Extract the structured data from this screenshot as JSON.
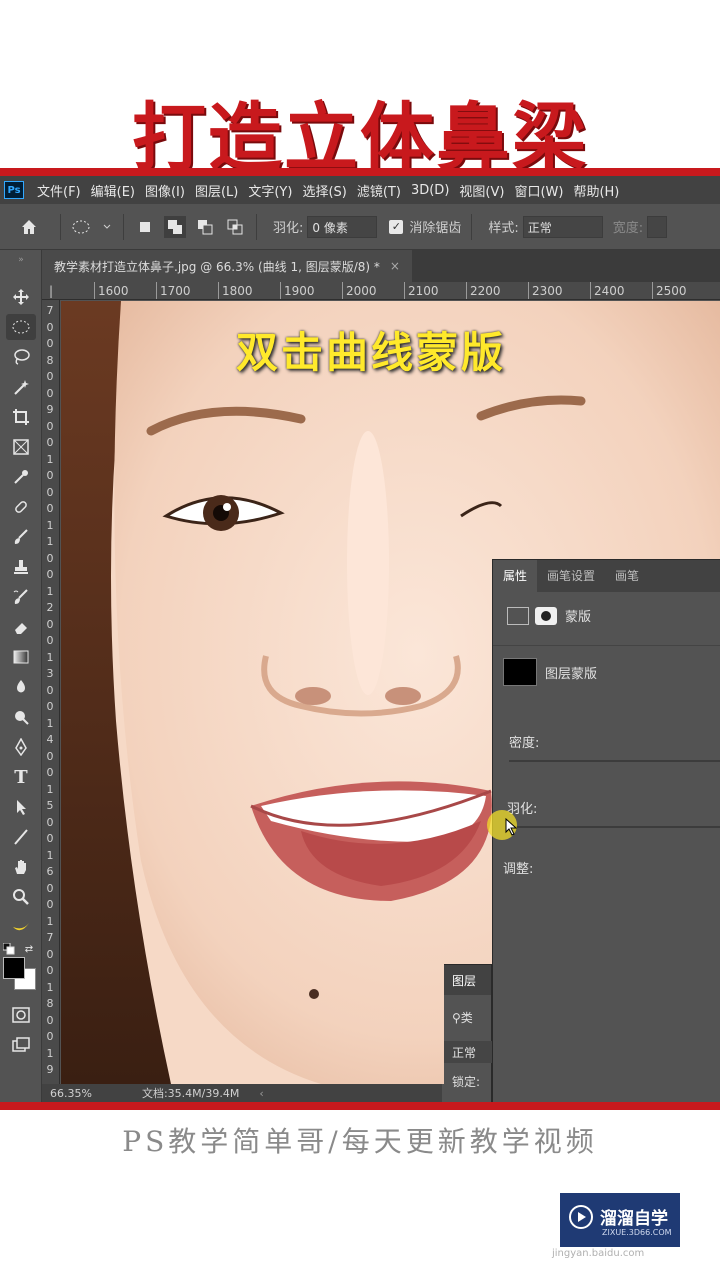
{
  "title": "打造立体鼻梁",
  "menu": [
    "文件(F)",
    "编辑(E)",
    "图像(I)",
    "图层(L)",
    "文字(Y)",
    "选择(S)",
    "滤镜(T)",
    "3D(D)",
    "视图(V)",
    "窗口(W)",
    "帮助(H)"
  ],
  "app_logo": "Ps",
  "options": {
    "feather_label": "羽化:",
    "feather_value": "0 像素",
    "antialias_label": "消除锯齿",
    "style_label": "样式:",
    "style_value": "正常",
    "width_label": "宽度:"
  },
  "document_tab": {
    "name": "教学素材打造立体鼻子.jpg @ 66.3% (曲线 1, 图层蒙版/8) *",
    "close": "×"
  },
  "ruler_h": [
    "1600",
    "1700",
    "1800",
    "1900",
    "2000",
    "2100",
    "2200",
    "2300",
    "2400",
    "2500"
  ],
  "ruler_v": [
    "7",
    "0",
    "0",
    "8",
    "0",
    "0",
    "9",
    "0",
    "0",
    "1",
    "0",
    "0",
    "0",
    "1",
    "1",
    "0",
    "0",
    "1",
    "2",
    "0",
    "0",
    "1",
    "3",
    "0",
    "0",
    "1",
    "4",
    "0",
    "0",
    "1",
    "5",
    "0",
    "0",
    "1",
    "6",
    "0",
    "0",
    "1",
    "7",
    "0",
    "0",
    "1",
    "8",
    "0",
    "0",
    "1",
    "9"
  ],
  "canvas_caption": "双击曲线蒙版",
  "properties": {
    "tabs": [
      "属性",
      "画笔设置",
      "画笔"
    ],
    "mask_label": "蒙版",
    "layer_mask_label": "图层蒙版",
    "density_label": "密度:",
    "feather_label": "羽化:",
    "adjust_label": "调整:"
  },
  "layers": {
    "tab": "图层",
    "search": "类",
    "blend_mode": "正常",
    "lock_label": "锁定:"
  },
  "status": {
    "zoom": "66.35%",
    "doc_size": "文档:35.4M/39.4M"
  },
  "bottom_caption": "PS教学简单哥/每天更新教学视频",
  "watermark": {
    "name": "溜溜自学",
    "url": "ZIXUE.3D66.COM"
  },
  "site": "jingyan.baidu.com",
  "colors": {
    "title_red": "#c8191d",
    "caption_yellow": "#ffe92b",
    "ps_bg": "#535353",
    "menubar": "#424242"
  }
}
